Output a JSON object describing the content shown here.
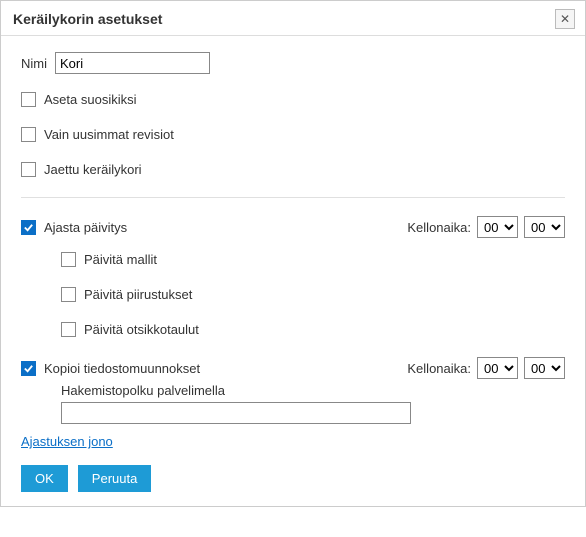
{
  "dialog": {
    "title": "Keräilykorin asetukset"
  },
  "form": {
    "name_label": "Nimi",
    "name_value": "Kori",
    "favorite_label": "Aseta suosikiksi",
    "favorite_checked": false,
    "latest_label": "Vain uusimmat revisiot",
    "latest_checked": false,
    "shared_label": "Jaettu keräilykori",
    "shared_checked": false,
    "schedule_update_label": "Ajasta päivitys",
    "schedule_update_checked": true,
    "time_label": "Kellonaika:",
    "hour_options": [
      "00"
    ],
    "minute_options": [
      "00"
    ],
    "schedule_hour": "00",
    "schedule_minute": "00",
    "update_templates_label": "Päivitä mallit",
    "update_templates_checked": false,
    "update_drawings_label": "Päivitä piirustukset",
    "update_drawings_checked": false,
    "update_titleblocks_label": "Päivitä otsikkotaulut",
    "update_titleblocks_checked": false,
    "copy_conversions_label": "Kopioi tiedostomuunnokset",
    "copy_conversions_checked": true,
    "copy_hour": "00",
    "copy_minute": "00",
    "path_label": "Hakemistopolku palvelimella",
    "path_value": "",
    "queue_link": "Ajastuksen jono",
    "ok_label": "OK",
    "cancel_label": "Peruuta"
  }
}
